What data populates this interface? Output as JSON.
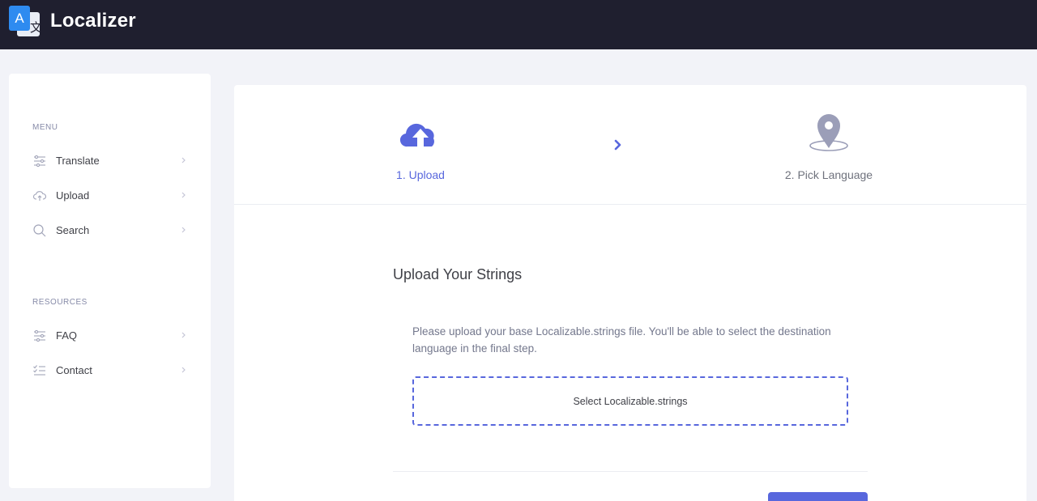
{
  "header": {
    "logo_glyph_a": "A",
    "logo_glyph_b": "文",
    "app_title": "Localizer"
  },
  "sidebar": {
    "menu_title": "MENU",
    "menu_items": [
      {
        "label": "Translate",
        "icon": "sliders-icon"
      },
      {
        "label": "Upload",
        "icon": "cloud-upload-icon"
      },
      {
        "label": "Search",
        "icon": "search-icon"
      }
    ],
    "resources_title": "RESOURCES",
    "resource_items": [
      {
        "label": "FAQ",
        "icon": "sliders-icon"
      },
      {
        "label": "Contact",
        "icon": "checklist-icon"
      }
    ]
  },
  "wizard": {
    "steps": [
      {
        "label": "1. Upload",
        "icon": "cloud-upload-icon",
        "state": "active"
      },
      {
        "label": "2. Pick Language",
        "icon": "map-pin-icon",
        "state": "pending"
      }
    ],
    "arrow_icon": "chevron-right-icon"
  },
  "upload": {
    "title": "Upload Your Strings",
    "description": "Please upload your base Localizable.strings file. You'll be able to select the destination language in the final step.",
    "file_button_label": "Select Localizable.strings"
  },
  "colors": {
    "accent": "#5867dd",
    "topbar": "#1f1f2f",
    "page_bg": "#f2f3f8"
  }
}
